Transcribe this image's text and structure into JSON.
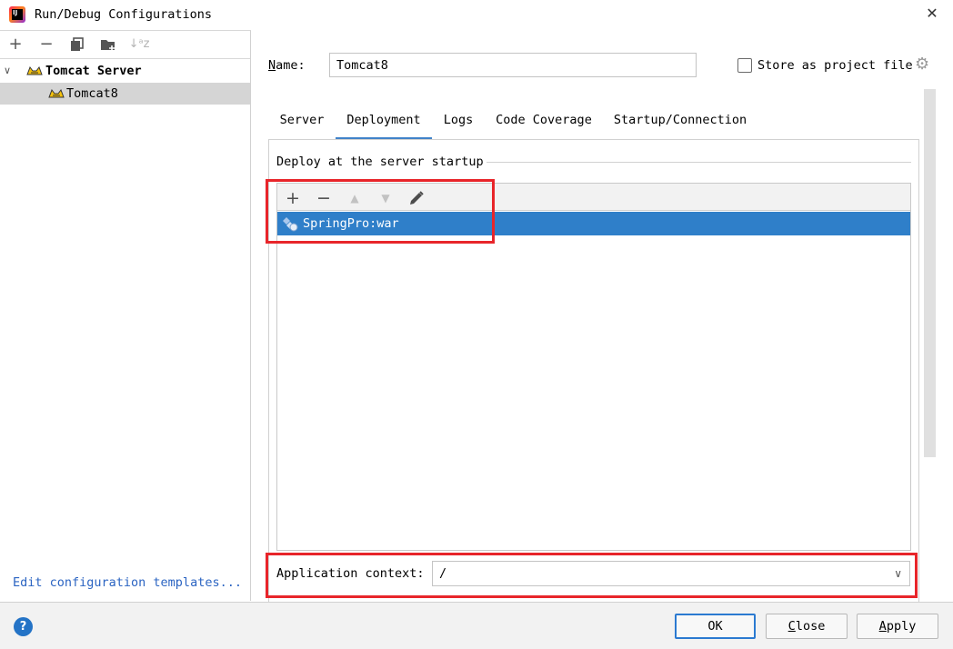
{
  "window": {
    "title": "Run/Debug Configurations"
  },
  "left": {
    "toolbar": {
      "add": "+",
      "remove": "−",
      "sort_label": "↓ᵃz"
    },
    "tree": {
      "group": "Tomcat Server",
      "item": "Tomcat8"
    },
    "edit_templates": "Edit configuration templates..."
  },
  "form": {
    "name_label_prefix": "N",
    "name_label_rest": "ame:",
    "name_value": "Tomcat8",
    "store_label": "Store as project file",
    "store_checked": false
  },
  "tabs": [
    {
      "label": "Server",
      "active": false
    },
    {
      "label": "Deployment",
      "active": true
    },
    {
      "label": "Logs",
      "active": false
    },
    {
      "label": "Code Coverage",
      "active": false
    },
    {
      "label": "Startup/Connection",
      "active": false
    }
  ],
  "deployment": {
    "section_title": "Deploy at the server startup",
    "toolbar": {
      "add": "+",
      "remove": "−",
      "up": "▲",
      "down": "▼"
    },
    "artifacts": [
      "SpringPro:war"
    ],
    "context_label": "Application context:",
    "context_value": "/"
  },
  "buttons": {
    "help": "?",
    "ok": "OK",
    "close_u": "C",
    "close_rest": "lose",
    "apply_u": "A",
    "apply_rest": "pply"
  },
  "colors": {
    "accent": "#2f7fc9",
    "highlight_box": "#e8252a",
    "link": "#2b64c2"
  }
}
